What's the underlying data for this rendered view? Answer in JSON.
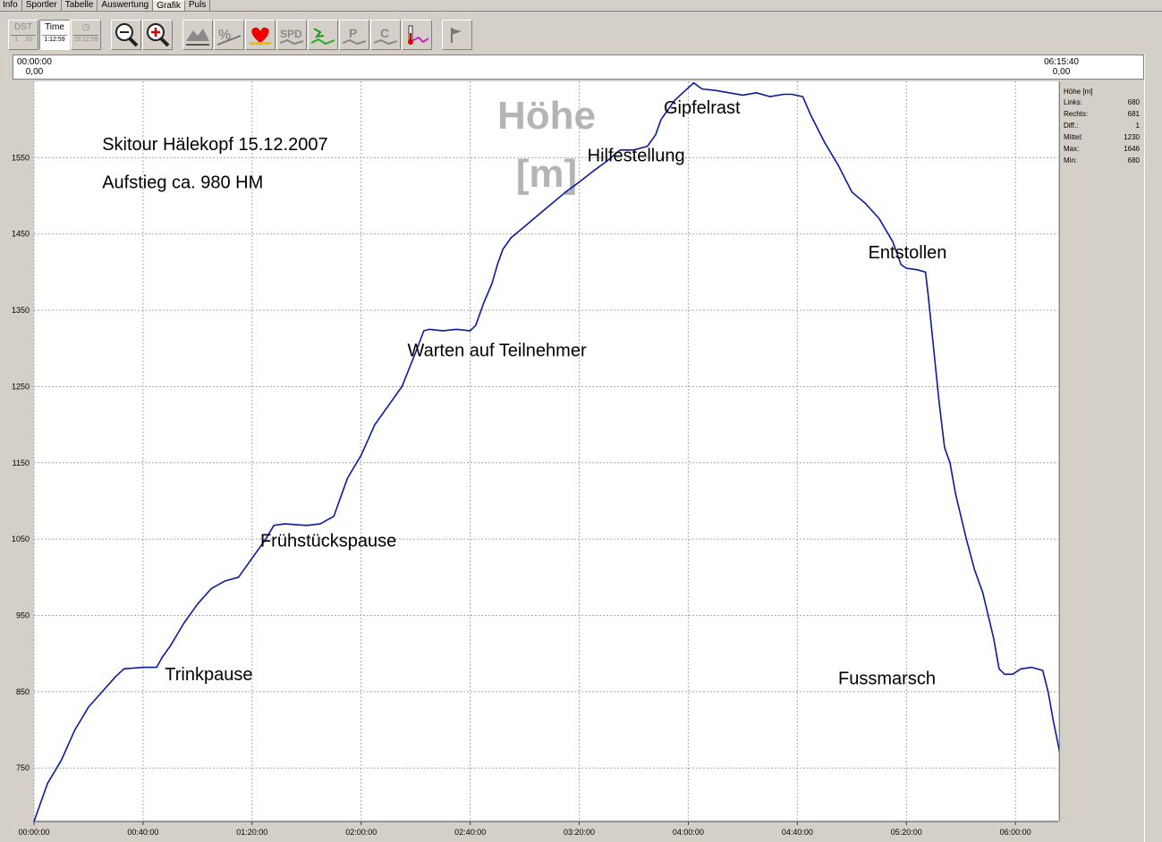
{
  "tabs": [
    "Info",
    "Sportler",
    "Tabelle",
    "Auswertung",
    "Grafik",
    "Puls"
  ],
  "active_tab": 4,
  "toolbar": {
    "dst": {
      "label": "DST",
      "a": "1",
      "b": "10"
    },
    "time": {
      "label": "Time",
      "value": "1:12:59"
    },
    "clock": {
      "value": "15:12:59"
    }
  },
  "icons": {
    "zoom_out": "zoom-out-icon",
    "zoom_in": "zoom-in-icon",
    "altitude": "altitude-icon",
    "incline": "incline-percent-icon",
    "heart": "heart-rate-icon",
    "speed": "speed-icon",
    "cadence": "cadence-icon",
    "power": "power-icon",
    "calories": "calories-icon",
    "temperature": "temperature-icon",
    "marker": "flag-marker-icon"
  },
  "range": {
    "left_time": "00:00:00",
    "left_value": "0,00",
    "right_time": "06:15:40",
    "right_value": "0,00"
  },
  "stats": {
    "title": "Höhe [m]",
    "rows": [
      {
        "label": "Links:",
        "value": "680"
      },
      {
        "label": "Rechts:",
        "value": "681"
      },
      {
        "label": "Diff.:",
        "value": "1"
      },
      {
        "label": "Mittel:",
        "value": "1230"
      },
      {
        "label": "Max:",
        "value": "1646"
      },
      {
        "label": "Min:",
        "value": "680"
      }
    ]
  },
  "colors": {
    "line": "#0a1aa0",
    "grid": "#a8a8a8",
    "watermark": "#b4b4b4"
  },
  "chart_data": {
    "type": "line",
    "title": "Höhe [m]",
    "xlabel": "",
    "ylabel": "",
    "y_ticks": [
      "750",
      "850",
      "950",
      "1050",
      "1150",
      "1250",
      "1350",
      "1450",
      "1550"
    ],
    "x_ticks": [
      "00:00:00",
      "00:40:00",
      "01:20:00",
      "02:00:00",
      "02:40:00",
      "03:20:00",
      "04:00:00",
      "04:40:00",
      "05:20:00",
      "06:00:00"
    ],
    "ylim": [
      680,
      1650
    ],
    "xlim_min": [
      0,
      375.7
    ],
    "grid": true,
    "series": [
      {
        "name": "Höhe [m]",
        "points": [
          [
            0,
            680
          ],
          [
            2,
            700
          ],
          [
            5,
            730
          ],
          [
            10,
            760
          ],
          [
            15,
            800
          ],
          [
            20,
            830
          ],
          [
            25,
            850
          ],
          [
            30,
            870
          ],
          [
            33,
            880
          ],
          [
            40,
            882
          ],
          [
            45,
            882
          ],
          [
            47,
            895
          ],
          [
            50,
            910
          ],
          [
            55,
            940
          ],
          [
            60,
            965
          ],
          [
            65,
            985
          ],
          [
            70,
            995
          ],
          [
            75,
            1000
          ],
          [
            80,
            1025
          ],
          [
            85,
            1050
          ],
          [
            88,
            1068
          ],
          [
            92,
            1070
          ],
          [
            100,
            1068
          ],
          [
            105,
            1070
          ],
          [
            110,
            1080
          ],
          [
            112,
            1100
          ],
          [
            115,
            1130
          ],
          [
            120,
            1160
          ],
          [
            125,
            1200
          ],
          [
            130,
            1225
          ],
          [
            135,
            1250
          ],
          [
            140,
            1295
          ],
          [
            143,
            1323
          ],
          [
            145,
            1325
          ],
          [
            150,
            1323
          ],
          [
            155,
            1325
          ],
          [
            160,
            1323
          ],
          [
            162,
            1330
          ],
          [
            165,
            1360
          ],
          [
            168,
            1385
          ],
          [
            170,
            1410
          ],
          [
            172,
            1430
          ],
          [
            175,
            1445
          ],
          [
            180,
            1460
          ],
          [
            185,
            1475
          ],
          [
            190,
            1490
          ],
          [
            195,
            1505
          ],
          [
            200,
            1518
          ],
          [
            205,
            1532
          ],
          [
            210,
            1545
          ],
          [
            215,
            1560
          ],
          [
            220,
            1560
          ],
          [
            225,
            1565
          ],
          [
            228,
            1580
          ],
          [
            230,
            1600
          ],
          [
            232,
            1610
          ],
          [
            235,
            1625
          ],
          [
            238,
            1635
          ],
          [
            242,
            1648
          ],
          [
            245,
            1640
          ],
          [
            250,
            1638
          ],
          [
            255,
            1635
          ],
          [
            260,
            1632
          ],
          [
            265,
            1635
          ],
          [
            270,
            1630
          ],
          [
            275,
            1633
          ],
          [
            278,
            1633
          ],
          [
            282,
            1630
          ],
          [
            285,
            1605
          ],
          [
            290,
            1570
          ],
          [
            295,
            1540
          ],
          [
            300,
            1505
          ],
          [
            305,
            1490
          ],
          [
            310,
            1470
          ],
          [
            315,
            1440
          ],
          [
            318,
            1410
          ],
          [
            320,
            1405
          ],
          [
            324,
            1403
          ],
          [
            327,
            1400
          ],
          [
            328,
            1370
          ],
          [
            330,
            1300
          ],
          [
            332,
            1230
          ],
          [
            334,
            1170
          ],
          [
            336,
            1150
          ],
          [
            338,
            1110
          ],
          [
            340,
            1080
          ],
          [
            342,
            1050
          ],
          [
            345,
            1010
          ],
          [
            348,
            980
          ],
          [
            350,
            950
          ],
          [
            352,
            920
          ],
          [
            354,
            880
          ],
          [
            356,
            873
          ],
          [
            359,
            873
          ],
          [
            362,
            880
          ],
          [
            366,
            882
          ],
          [
            370,
            878
          ],
          [
            372,
            850
          ],
          [
            374,
            810
          ],
          [
            376,
            775
          ],
          [
            378,
            740
          ],
          [
            380,
            705
          ],
          [
            382,
            685
          ],
          [
            386,
            682
          ],
          [
            388,
            682
          ]
        ]
      }
    ],
    "annotations": [
      {
        "text": "Skitour Hälekopf 15.12.2007",
        "at": [
          25,
          1560
        ]
      },
      {
        "text": "Aufstieg ca. 980 HM",
        "at": [
          25,
          1510
        ]
      },
      {
        "text": "Trinkpause",
        "at": [
          48,
          865
        ]
      },
      {
        "text": "Frühstückspause",
        "at": [
          83,
          1040
        ]
      },
      {
        "text": "Warten auf Teilnehmer",
        "at": [
          137,
          1290
        ]
      },
      {
        "text": "Hilfestellung",
        "at": [
          203,
          1545
        ]
      },
      {
        "text": "Gipfelrast",
        "at": [
          231,
          1608
        ]
      },
      {
        "text": "Entstollen",
        "at": [
          306,
          1418
        ]
      },
      {
        "text": "Fussmarsch",
        "at": [
          295,
          860
        ]
      }
    ]
  }
}
